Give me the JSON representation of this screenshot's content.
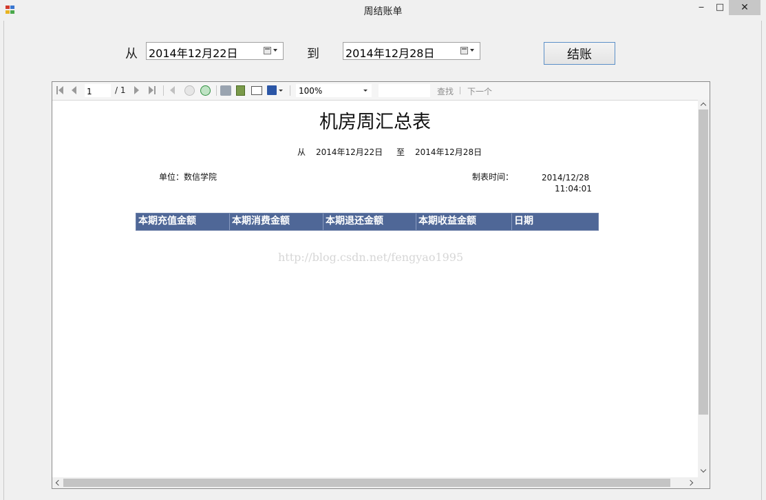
{
  "window": {
    "title": "周结账单",
    "controls": {
      "minimize": "‒",
      "maximize": "□",
      "close": "✕"
    }
  },
  "form": {
    "from_label": "从",
    "from_date": "2014年12月22日",
    "to_label": "到",
    "to_date": "2014年12月28日",
    "checkout_button": "结账"
  },
  "toolbar": {
    "page_number": "1",
    "page_total": "/ 1",
    "zoom": "100%",
    "find_label": "查找",
    "next_label": "下一个"
  },
  "report": {
    "title": "机房周汇总表",
    "range_from_label": "从",
    "range_from_date": "2014年12月22日",
    "range_to_label": "至",
    "range_to_date": "2014年12月28日",
    "unit_label": "单位：数信学院",
    "created_label": "制表时间：",
    "created_date": "2014/12/28",
    "created_time": "11:04:01",
    "columns": [
      "本期充值金额",
      "本期消费金额",
      "本期退还金额",
      "本期收益金额",
      "日期"
    ],
    "watermark": "http://blog.csdn.net/fengyao1995"
  },
  "colors": {
    "header_bg": "#4f6797",
    "accent_border": "#5a8fc7"
  }
}
